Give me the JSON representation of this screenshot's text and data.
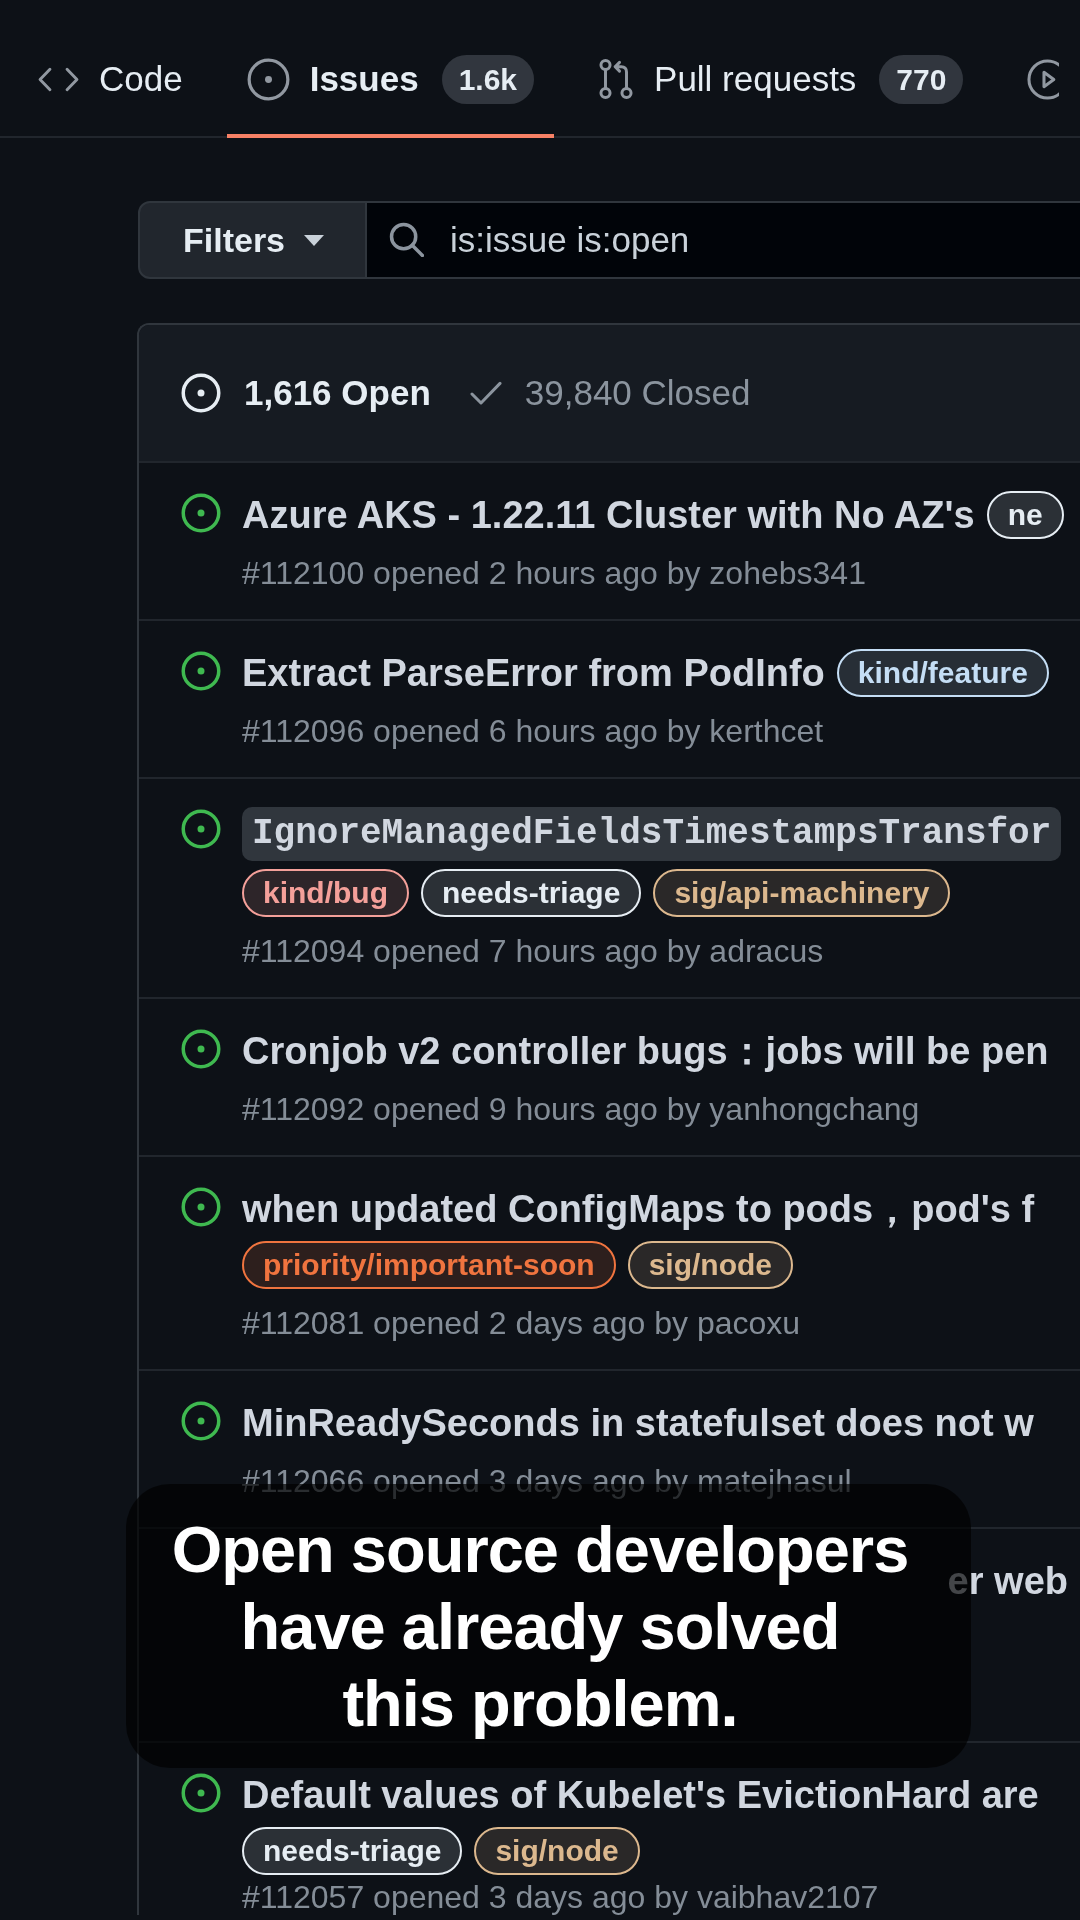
{
  "tabs": [
    {
      "kind": "code",
      "label": "Code",
      "selected": false
    },
    {
      "kind": "issues",
      "label": "Issues",
      "counter": "1.6k",
      "selected": true
    },
    {
      "kind": "pulls",
      "label": "Pull requests",
      "counter": "770",
      "selected": false
    },
    {
      "kind": "actions",
      "selected": false
    }
  ],
  "filter_bar": {
    "button": "Filters",
    "search": {
      "value": "is:issue is:open"
    }
  },
  "issue_list": {
    "states": [
      {
        "kind": "open",
        "label": "1,616 Open",
        "selected": true
      },
      {
        "kind": "closed",
        "label": "39,840 Closed",
        "selected": false
      }
    ],
    "issues": [
      {
        "title": "Azure AKS - 1.22.11 Cluster with No AZ's",
        "code": false,
        "labels": [
          {
            "name": "ne",
            "color": "#e6edf3"
          }
        ],
        "meta": [
          "#112100 opened 2 hours ago by zohebs341"
        ]
      },
      {
        "title": "Extract ParseError from PodInfo",
        "code": false,
        "labels": [
          {
            "name": "kind/feature",
            "color": "#c5def5"
          }
        ],
        "meta": [
          "#112096 opened 6 hours ago by kerthcet"
        ]
      },
      {
        "title": "IgnoreManagedFieldsTimestampsTransfor",
        "code": true,
        "labels": [
          {
            "name": "kind/bug",
            "color": "#f4a09a"
          },
          {
            "name": "needs-triage",
            "color": "#e6edf3"
          },
          {
            "name": "sig/api-machinery",
            "color": "#dcb88e"
          }
        ],
        "meta": [
          "#112094 opened 7 hours ago by adracus"
        ]
      },
      {
        "title": "Cronjob v2 controller bugs：jobs will be pen",
        "code": false,
        "meta": [
          "#112092 opened 9 hours ago by yanhongchang"
        ]
      },
      {
        "title": "when updated ConfigMaps to pods，pod's f",
        "code": false,
        "labels": [
          {
            "name": "priority/important-soon",
            "color": "#f0743f"
          },
          {
            "name": "sig/node",
            "color": "#dcb88e"
          }
        ],
        "meta": [
          "#112081 opened 2 days ago by pacoxu"
        ]
      },
      {
        "title": "MinReadySeconds in statefulset does not w",
        "code": false,
        "meta": [
          "#112066 opened 3 days ago by matejhasul"
        ]
      },
      {
        "title": "er web",
        "code": false
      },
      {
        "title": "Default values of Kubelet's EvictionHard are",
        "code": false,
        "labels": [
          {
            "name": "needs-triage",
            "color": "#e6edf3"
          },
          {
            "name": "sig/node",
            "color": "#dcb88e"
          }
        ],
        "meta": [
          "#112057 opened 3 days ago by vaibhav2107"
        ]
      }
    ]
  },
  "caption": {
    "lines": [
      "Open source developers",
      "have already solved",
      "this problem."
    ]
  }
}
